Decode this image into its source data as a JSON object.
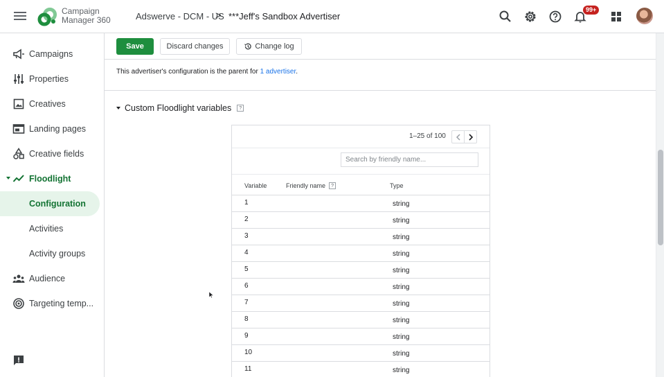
{
  "app": {
    "name_line1": "Campaign",
    "name_line2": "Manager 360",
    "logo_color_primary": "#1e8e3e",
    "logo_color_secondary": "#81c995"
  },
  "breadcrumb": {
    "account": "Adswerve - DCM - US",
    "separator": ">",
    "advertiser": "***Jeff's Sandbox Advertiser"
  },
  "topbar": {
    "icons": [
      "search-icon",
      "gear-icon",
      "help-icon",
      "bell-icon",
      "apps-grid-icon"
    ],
    "notification_badge": "99+"
  },
  "sidebar": {
    "items": [
      {
        "label": "Campaigns",
        "icon": "megaphone-icon"
      },
      {
        "label": "Properties",
        "icon": "sliders-icon"
      },
      {
        "label": "Creatives",
        "icon": "image-icon"
      },
      {
        "label": "Landing pages",
        "icon": "webpage-icon"
      },
      {
        "label": "Creative fields",
        "icon": "shapes-icon"
      },
      {
        "label": "Floodlight",
        "icon": "trend-line-icon"
      },
      {
        "label": "Configuration",
        "icon": ""
      },
      {
        "label": "Activities",
        "icon": ""
      },
      {
        "label": "Activity groups",
        "icon": ""
      },
      {
        "label": "Audience",
        "icon": "people-icon"
      },
      {
        "label": "Targeting temp...",
        "icon": "target-icon"
      }
    ],
    "active_item": "Configuration"
  },
  "toolbar": {
    "save_label": "Save",
    "discard_label": "Discard changes",
    "changelog_label": "Change log",
    "save_color": "#1e8e3e"
  },
  "notice": {
    "text": "This advertiser's configuration is the parent for ",
    "link": "1 advertiser",
    "suffix": "."
  },
  "section": {
    "title": "Custom Floodlight variables",
    "help": "?"
  },
  "table": {
    "pager_text": "1–25 of 100",
    "search_placeholder": "Search by friendly name...",
    "columns": {
      "variable": "Variable",
      "friendly_name": "Friendly name",
      "friendly_help": "?",
      "type": "Type"
    },
    "rows": [
      {
        "variable": "1",
        "type": "string"
      },
      {
        "variable": "2",
        "type": "string"
      },
      {
        "variable": "3",
        "type": "string"
      },
      {
        "variable": "4",
        "type": "string"
      },
      {
        "variable": "5",
        "type": "string"
      },
      {
        "variable": "6",
        "type": "string"
      },
      {
        "variable": "7",
        "type": "string"
      },
      {
        "variable": "8",
        "type": "string"
      },
      {
        "variable": "9",
        "type": "string"
      },
      {
        "variable": "10",
        "type": "string"
      },
      {
        "variable": "11",
        "type": "string"
      }
    ]
  }
}
